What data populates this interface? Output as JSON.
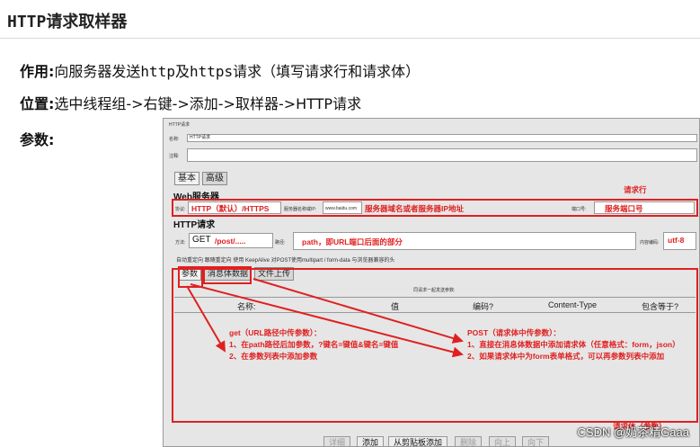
{
  "slide": {
    "title": "HTTP请求取样器",
    "usage_label": "作用:",
    "usage_text_1": "向服务器发送",
    "usage_http": "http",
    "usage_and": "及",
    "usage_https": "https",
    "usage_text_2": "请求（填写请求行和请求体）",
    "location_label": "位置:",
    "location_text": "选中线程组->右键->添加->取样器->HTTP请求",
    "params_label": "参数:"
  },
  "jmeter": {
    "panel_title": "HTTP请求",
    "name_label": "名称:",
    "name_value": "HTTP请求",
    "comment_label": "注释:",
    "tabs": [
      "基本",
      "高级"
    ],
    "web_server": "Web服务器",
    "protocol_label": "协议:",
    "protocol_value": "HTTP（默认）/HTTPS",
    "server_label": "服务器名称或IP:",
    "server_value": "www.baidu.com",
    "server_note": "服务器域名或者服务器IP地址",
    "port_label": "端口号:",
    "port_note": "服务端口号",
    "http_request": "HTTP请求",
    "method_label": "方法:",
    "method_value": "GET",
    "method_path": "/post/.....",
    "path_label": "路径:",
    "path_note": "path，即URL端口后面的部分",
    "encoding_label": "内容编码:",
    "encoding_value": "utf-8",
    "checkboxes": "自动重定向   跟随重定向   使用 KeepAlive   对POST使用multipart / form-data   与浏览器兼容的头",
    "subtabs": [
      "参数",
      "消息体数据",
      "文件上传"
    ],
    "table_caption": "同请求一起发送参数:",
    "columns": [
      "名称:",
      "值",
      "编码?",
      "Content-Type",
      "包含等于?"
    ],
    "buttons": [
      "详细",
      "添加",
      "从剪贴板添加",
      "删除",
      "向上",
      "向下"
    ]
  },
  "annotations": {
    "request_line": "请求行",
    "request_body": "请求体（参数）",
    "get_title": "get（URL路径中传参数）：",
    "get_1": "1、在path路径后加参数，?键名=键值&键名=键值",
    "get_2": "2、在参数列表中添加参数",
    "post_title": "POST（请求体中传参数）：",
    "post_1": "1、直接在消息体数据中添加请求体（任意格式：form，json）",
    "post_2": "2、如果请求体中为form表单格式，可以再参数列表中添加"
  },
  "watermark": "CSDN @奶茶精Gaaa",
  "colors": {
    "annotation": "#e02020"
  }
}
